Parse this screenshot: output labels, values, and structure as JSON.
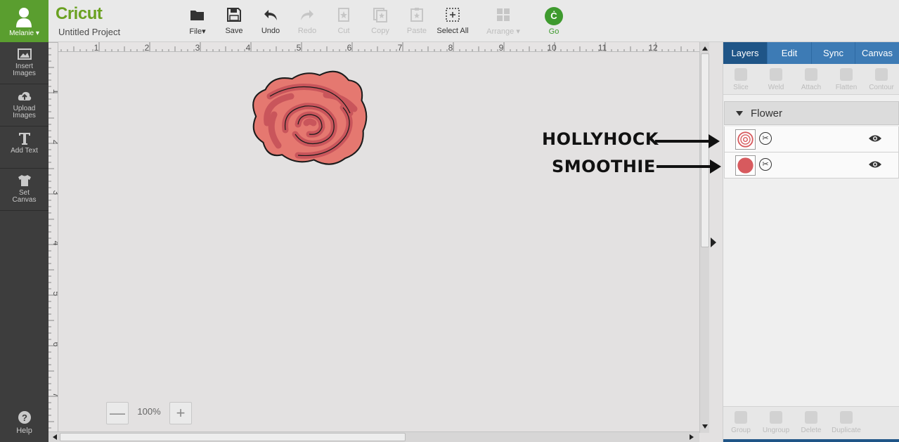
{
  "user": {
    "name": "Melanie"
  },
  "sidebar": {
    "items": [
      {
        "label": "Insert Images",
        "icon": "image-icon"
      },
      {
        "label": "Upload Images",
        "icon": "cloud-upload-icon"
      },
      {
        "label": "Add Text",
        "icon": "text-icon"
      },
      {
        "label": "Set Canvas",
        "icon": "tshirt-icon"
      }
    ],
    "help": "Help"
  },
  "header": {
    "logo": "Cricut",
    "project": "Untitled Project"
  },
  "toolbar": {
    "file": "File",
    "save": "Save",
    "undo": "Undo",
    "redo": "Redo",
    "cut": "Cut",
    "copy": "Copy",
    "paste": "Paste",
    "select_all": "Select All",
    "arrange": "Arrange",
    "go": "Go",
    "go_icon": "Ċ"
  },
  "ruler": {
    "top": [
      "1",
      "2",
      "3",
      "4",
      "5",
      "6",
      "7",
      "8",
      "9",
      "10",
      "11",
      "12"
    ],
    "left": [
      "1",
      "2",
      "3",
      "4",
      "5",
      "6",
      "7"
    ]
  },
  "zoom": {
    "level": "100%",
    "minus": "—",
    "plus": "+"
  },
  "panel": {
    "tabs": [
      "Layers",
      "Edit",
      "Sync",
      "Canvas"
    ],
    "active_tab": "Layers",
    "tools": [
      "Slice",
      "Weld",
      "Attach",
      "Flatten",
      "Contour"
    ],
    "group_name": "Flower",
    "layers": [
      {
        "color": "#d75a5e",
        "type": "outline"
      },
      {
        "color": "#d75a5e",
        "type": "solid"
      }
    ],
    "bottom_tools": [
      "Group",
      "Ungroup",
      "Delete",
      "Duplicate"
    ]
  },
  "annotations": [
    "HOLLYHOCK",
    "SMOOTHIE"
  ],
  "colors": {
    "brand_green": "#6aa121",
    "tab_blue": "#3d7bb5",
    "tab_active": "#1f5587",
    "rose_dark": "#c9555b",
    "rose_light": "#e57870"
  }
}
